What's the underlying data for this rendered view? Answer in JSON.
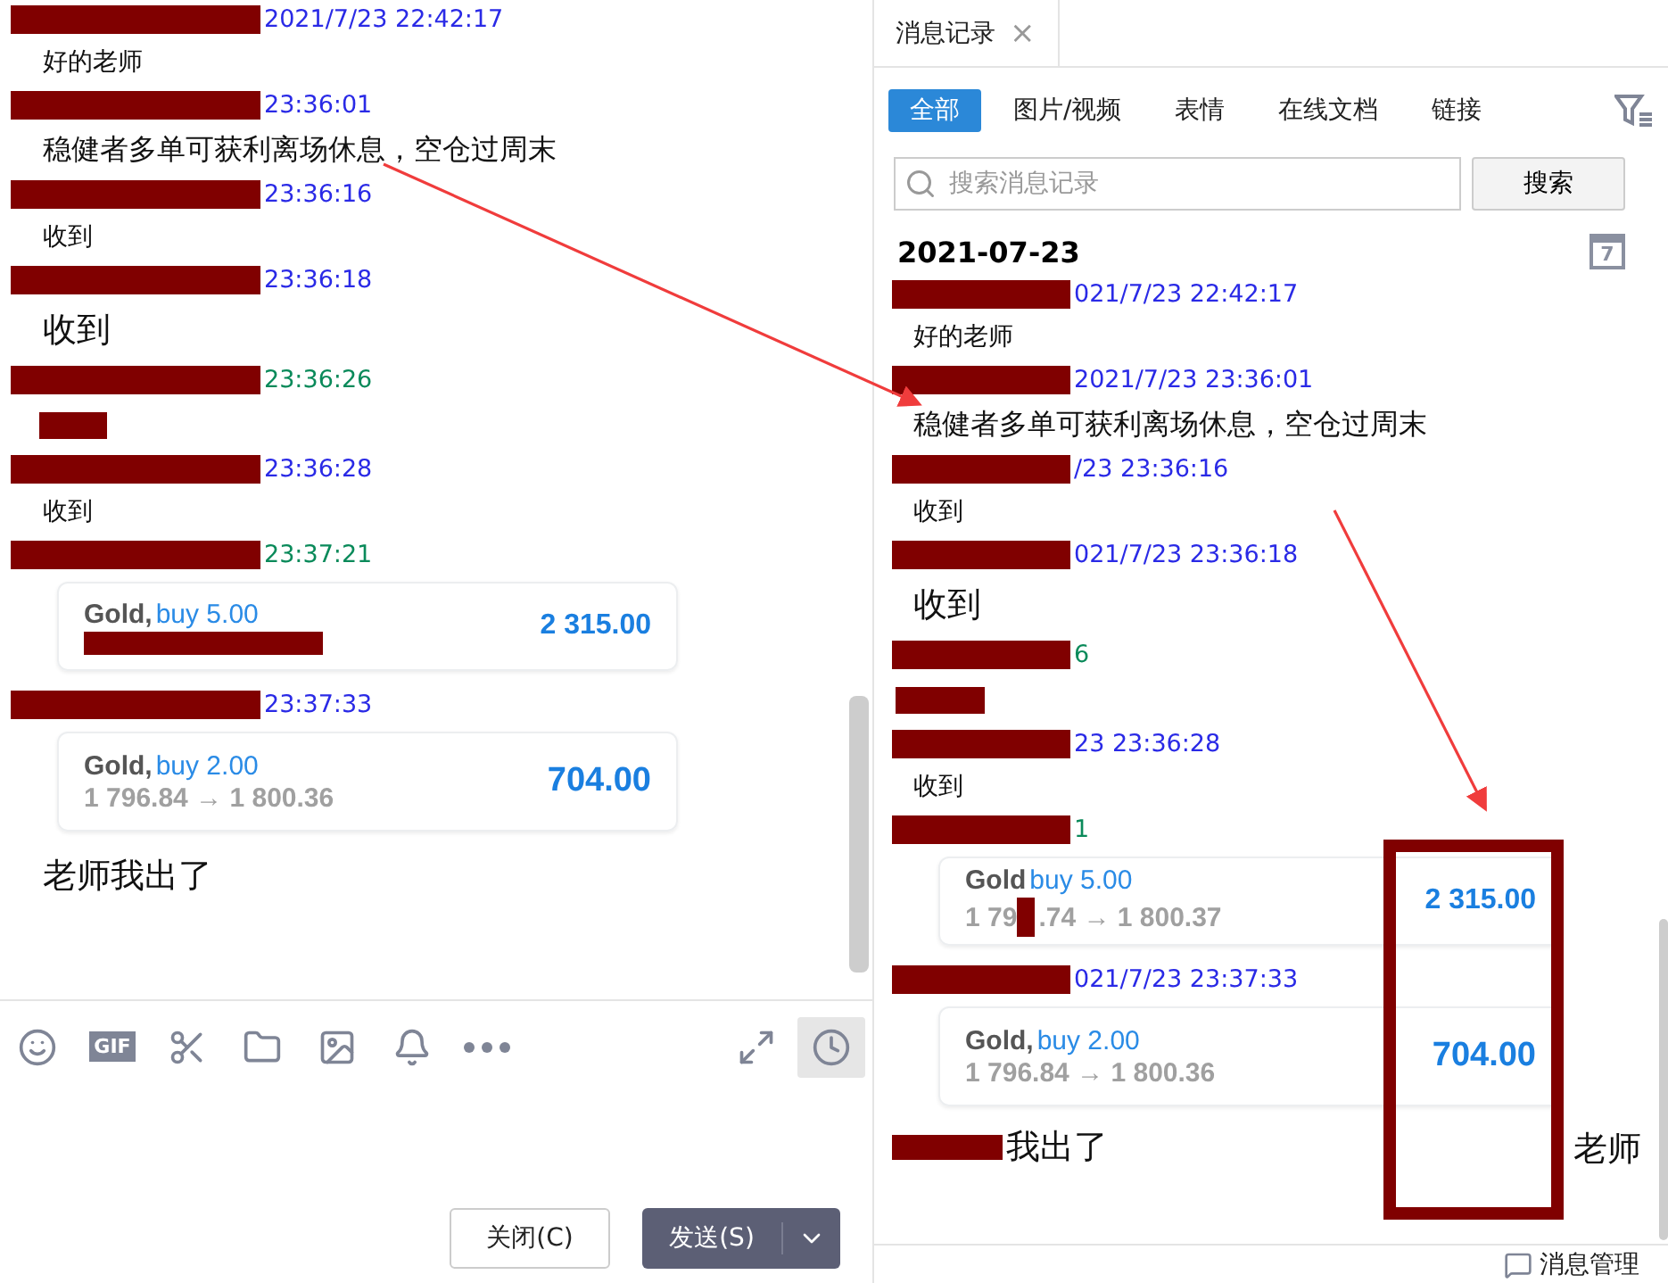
{
  "chat": {
    "messages": [
      {
        "time": "2021/7/23 22:42:17",
        "color": "#2a2ae6",
        "kind": "small",
        "text": "好的老师"
      },
      {
        "time": "23:36:01",
        "color": "#2a2ae6",
        "kind": "medium",
        "text": "稳健者多单可获利离场休息，空仓过周末"
      },
      {
        "time": "23:36:16",
        "color": "#2a2ae6",
        "kind": "small",
        "text": "收到"
      },
      {
        "time": "23:36:18",
        "color": "#2a2ae6",
        "kind": "large",
        "text": "收到"
      },
      {
        "time": "23:36:26",
        "color": "#0a8a5a",
        "kind": "hidden"
      },
      {
        "time": "23:36:28",
        "color": "#2a2ae6",
        "kind": "small",
        "text": "收到"
      },
      {
        "time": "23:37:21",
        "color": "#0a8a5a",
        "kind": "card",
        "symbol": "Gold,",
        "side": "buy 5.00",
        "profit": "2 315.00"
      },
      {
        "time": "23:37:33",
        "color": "#2a2ae6",
        "kind": "card",
        "symbol": "Gold,",
        "side": "buy 2.00",
        "prices": [
          "1 796.84 → 1 800.36"
        ],
        "profit": "704.00"
      },
      {
        "kind": "large",
        "text": "老师我出了"
      }
    ],
    "toolbar": {
      "gif_label": "GIF",
      "tools": [
        {
          "kind": "smile",
          "selected": false
        },
        {
          "kind": "gif",
          "selected": false
        },
        {
          "kind": "scissors",
          "selected": false
        },
        {
          "kind": "folder",
          "selected": false
        },
        {
          "kind": "image",
          "selected": false
        },
        {
          "kind": "bell",
          "selected": false
        },
        {
          "kind": "more",
          "selected": false
        },
        {
          "kind": "expand",
          "selected": false
        },
        {
          "kind": "clock",
          "selected": true
        }
      ]
    },
    "buttons": {
      "close": "关闭(C)",
      "send": "发送(S)"
    }
  },
  "history": {
    "tab": {
      "title": "消息记录",
      "close": "×"
    },
    "filters": [
      {
        "label": "全部",
        "selected": true
      },
      {
        "label": "图片/视频",
        "selected": false
      },
      {
        "label": "表情",
        "selected": false
      },
      {
        "label": "在线文档",
        "selected": false
      },
      {
        "label": "链接",
        "selected": false
      }
    ],
    "search": {
      "placeholder": "搜索消息记录",
      "button": "搜索"
    },
    "date": "2021-07-23",
    "calendar_day": "7",
    "messages": [
      {
        "time": "021/7/23 22:42:17",
        "color": "#2a2ae6",
        "kind": "small",
        "text": "好的老师"
      },
      {
        "time": "2021/7/23 23:36:01",
        "color": "#2a2ae6",
        "kind": "medium",
        "text": "稳健者多单可获利离场休息，空仓过周末"
      },
      {
        "time": "/23 23:36:16",
        "color": "#2a2ae6",
        "kind": "small",
        "text": "收到"
      },
      {
        "time": "021/7/23 23:36:18",
        "color": "#2a2ae6",
        "kind": "large",
        "text": "收到"
      },
      {
        "time": "6",
        "color": "#0a8a5a",
        "kind": "hidden"
      },
      {
        "time": "23 23:36:28",
        "color": "#2a2ae6",
        "kind": "small",
        "text": "收到"
      },
      {
        "time": "1",
        "color": "#0a8a5a",
        "kind": "card",
        "symbol": "Gold",
        "side": "buy 5.00",
        "prices": [
          "1 79",
          ".74 → 1 800.37"
        ],
        "profit": "2 315.00"
      },
      {
        "time": "021/7/23 23:37:33",
        "color": "#2a2ae6",
        "kind": "card",
        "symbol": "Gold,",
        "side": "buy 2.00",
        "prices": [
          "1 796.84 → 1 800.36"
        ],
        "profit": "704.00"
      },
      {
        "kind": "covered",
        "text": "我出了"
      }
    ],
    "footer": "消息管理"
  },
  "annotations": {
    "note": "老师"
  }
}
